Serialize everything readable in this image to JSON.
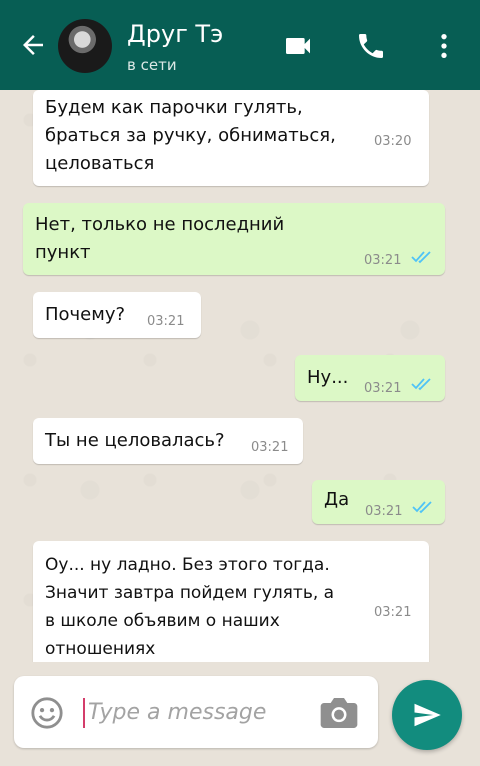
{
  "header": {
    "title": "Друг Тэ",
    "status": "в сети"
  },
  "messages": [
    {
      "direction": "in",
      "text": "Будем как парочки гулять,\nбраться за ручку, обниматься,\nцеловаться",
      "time": "03:20"
    },
    {
      "direction": "out",
      "text": "Нет, только  не последний\nпункт",
      "time": "03:21",
      "status": "read"
    },
    {
      "direction": "in",
      "text": "Почему?",
      "time": "03:21"
    },
    {
      "direction": "out",
      "text": "Ну...",
      "time": "03:21",
      "status": "read"
    },
    {
      "direction": "in",
      "text": "Ты не целовалась?",
      "time": "03:21"
    },
    {
      "direction": "out",
      "text": "Да",
      "time": "03:21",
      "status": "read"
    },
    {
      "direction": "in",
      "text": "Оу... ну ладно.  Без этого тогда.\nЗначит завтра пойдем гулять, а\nв школе объявим о наших\nотношениях",
      "time": "03:21"
    }
  ],
  "composer": {
    "placeholder": "Type a message"
  },
  "colors": {
    "header": "#075e54",
    "outgoing_bubble": "#dcf8c6",
    "incoming_bubble": "#ffffff",
    "send_button": "#128c7e",
    "read_ticks": "#4fc3f7"
  },
  "icons": {
    "back": "arrow-left-icon",
    "video": "video-camera-icon",
    "call": "phone-icon",
    "menu": "more-vertical-icon",
    "emoji": "smiley-icon",
    "camera": "camera-icon",
    "send": "send-icon"
  }
}
